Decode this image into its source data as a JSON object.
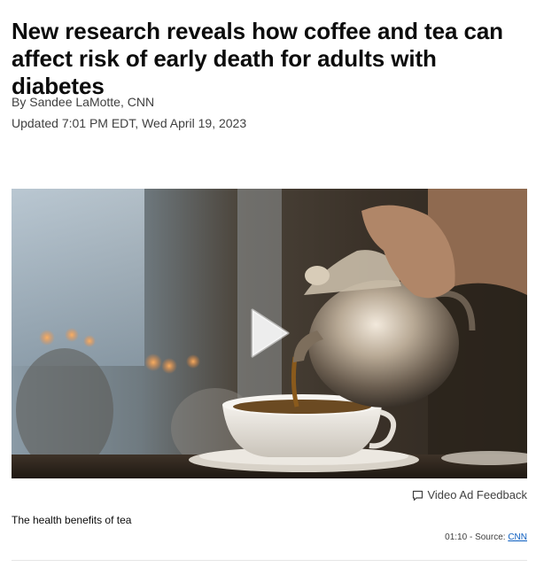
{
  "article": {
    "headline": "New research reveals how coffee and tea can affect risk of early death for adults with diabetes",
    "byline": "By Sandee LaMotte, CNN",
    "updated": "Updated 7:01 PM EDT, Wed April 19, 2023"
  },
  "video": {
    "image_description_icon": "play-icon",
    "ad_feedback_label": "Video Ad Feedback",
    "caption": "The health benefits of tea",
    "duration": "01:10",
    "source_prefix": " - Source: ",
    "source_link": "CNN"
  },
  "colors": {
    "text": "#0c0c0c",
    "meta": "#404040",
    "link": "#0c5ec0",
    "divider": "#e6e6e6"
  }
}
